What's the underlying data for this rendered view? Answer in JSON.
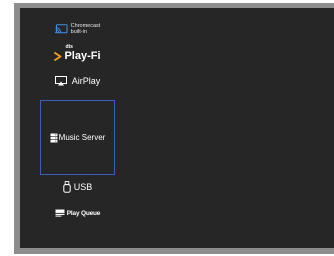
{
  "sources": {
    "chromecast": {
      "line1": "Chromecast",
      "line2": "built-in"
    },
    "playfi": {
      "dts": "dts",
      "label": "Play-Fi"
    },
    "airplay": {
      "label": "AirPlay"
    },
    "music_server": {
      "label": "Music Server",
      "selected": true
    },
    "usb": {
      "label": "USB"
    },
    "play_queue": {
      "label": "Play Queue"
    }
  },
  "colors": {
    "background": "#262626",
    "frame": "#8d8d8d",
    "selection_border": "#3d5fb8",
    "playfi_accent": "#f5a11c",
    "text": "#ffffff"
  }
}
